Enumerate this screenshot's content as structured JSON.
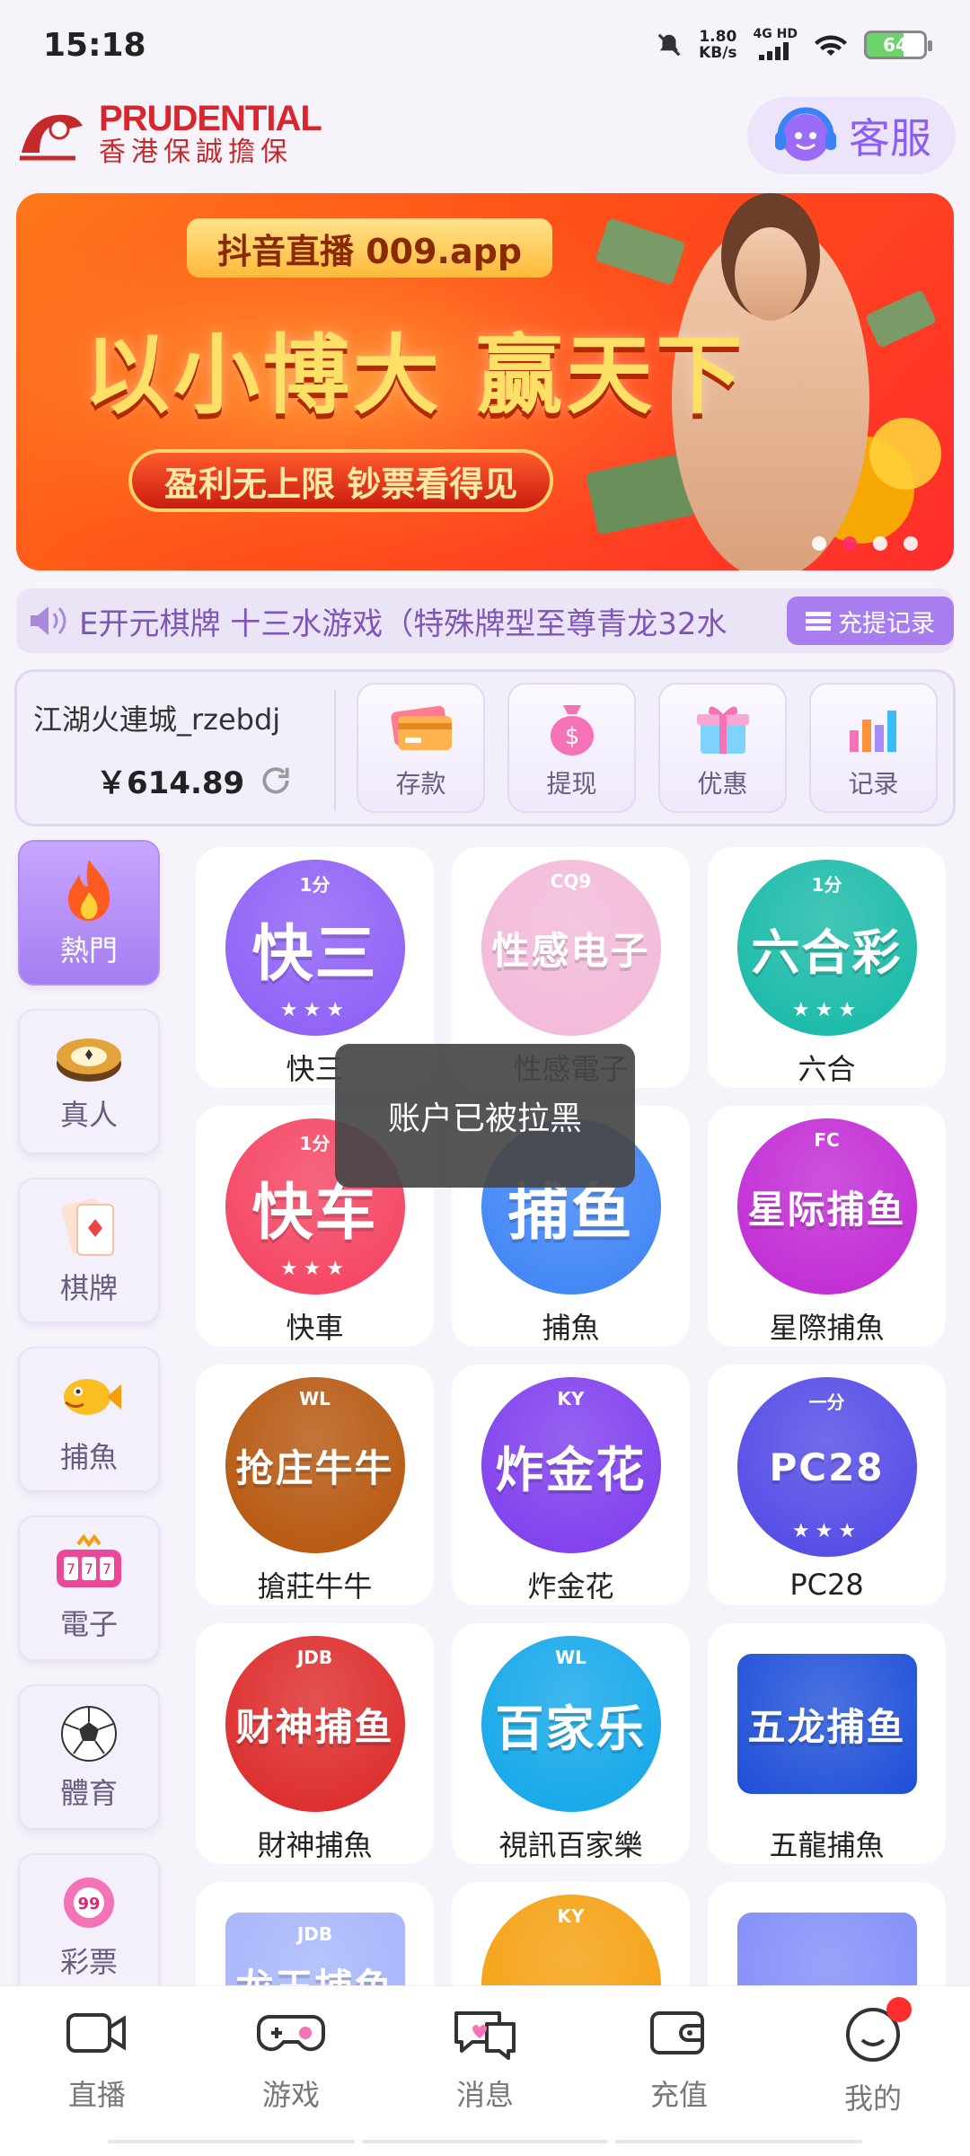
{
  "status_bar": {
    "time": "15:18",
    "net_speed_value": "1.80",
    "net_speed_unit": "KB/s",
    "network": "4G HD",
    "battery": "64"
  },
  "header": {
    "logo_en": "PRUDENTIAL",
    "logo_cn": "香港保誠擔保",
    "service_label": "客服"
  },
  "banner": {
    "top_text": "抖音直播 009.app",
    "main_text": "以小博大 赢天下",
    "sub_text": "盈利无上限 钞票看得见",
    "dots": 4,
    "active_dot": 1
  },
  "marquee": {
    "text": "E开元棋牌 十三水游戏（特殊牌型至尊青龙32水",
    "record_label": "充提记录"
  },
  "account": {
    "name": "江湖火連城_rzebdj",
    "balance": "￥614.89",
    "actions": [
      {
        "label": "存款",
        "icon": "card-icon"
      },
      {
        "label": "提现",
        "icon": "money-bag-icon"
      },
      {
        "label": "优惠",
        "icon": "gift-icon"
      },
      {
        "label": "记录",
        "icon": "bar-chart-icon"
      }
    ]
  },
  "categories": [
    {
      "label": "熱門",
      "icon": "fire-icon",
      "active": true
    },
    {
      "label": "真人",
      "icon": "chip-icon"
    },
    {
      "label": "棋牌",
      "icon": "card-icon"
    },
    {
      "label": "捕魚",
      "icon": "fish-icon"
    },
    {
      "label": "電子",
      "icon": "slot-icon"
    },
    {
      "label": "體育",
      "icon": "soccer-icon"
    },
    {
      "label": "彩票",
      "icon": "lottery-ball-icon"
    }
  ],
  "games": [
    {
      "label": "快三",
      "icon_text": "快三",
      "sub": "1分",
      "color": "#8b5cf6"
    },
    {
      "label": "性感電子",
      "icon_text": "性感电子",
      "sub": "CQ9",
      "color": "#f2b8d8"
    },
    {
      "label": "六合",
      "icon_text": "六合彩",
      "sub": "1分",
      "color": "#14b8a6"
    },
    {
      "label": "快車",
      "icon_text": "快车",
      "sub": "1分",
      "color": "#f43f5e"
    },
    {
      "label": "捕魚",
      "icon_text": "捕鱼",
      "sub": "",
      "color": "#3b82f6"
    },
    {
      "label": "星際捕魚",
      "icon_text": "星际捕鱼",
      "sub": "FC",
      "color": "#c026d3"
    },
    {
      "label": "搶莊牛牛",
      "icon_text": "抢庄牛牛",
      "sub": "WL",
      "color": "#b45309"
    },
    {
      "label": "炸金花",
      "icon_text": "炸金花",
      "sub": "KY",
      "color": "#7c3aed"
    },
    {
      "label": "PC28",
      "icon_text": "PC28",
      "sub": "一分",
      "color": "#4f46e5"
    },
    {
      "label": "財神捕魚",
      "icon_text": "财神捕鱼",
      "sub": "JDB",
      "color": "#dc2626"
    },
    {
      "label": "視訊百家樂",
      "icon_text": "百家乐",
      "sub": "WL",
      "color": "#0ea5e9"
    },
    {
      "label": "五龍捕魚",
      "icon_text": "五龙捕鱼",
      "sub": "",
      "color": "#1d4ed8"
    },
    {
      "label": "",
      "icon_text": "龙王捕鱼",
      "sub": "JDB",
      "color": "#a5b4fc"
    },
    {
      "label": "",
      "icon_text": "",
      "sub": "KY",
      "color": "#f59e0b"
    },
    {
      "label": "",
      "icon_text": "",
      "sub": "",
      "color": "#818cf8"
    }
  ],
  "toast": {
    "text": "账户已被拉黑"
  },
  "bottom_nav": [
    {
      "label": "直播",
      "icon": "video-camera-icon"
    },
    {
      "label": "游戏",
      "icon": "gamepad-icon"
    },
    {
      "label": "消息",
      "icon": "chat-icon"
    },
    {
      "label": "充值",
      "icon": "wallet-icon"
    },
    {
      "label": "我的",
      "icon": "smiley-icon",
      "badge": true
    }
  ]
}
